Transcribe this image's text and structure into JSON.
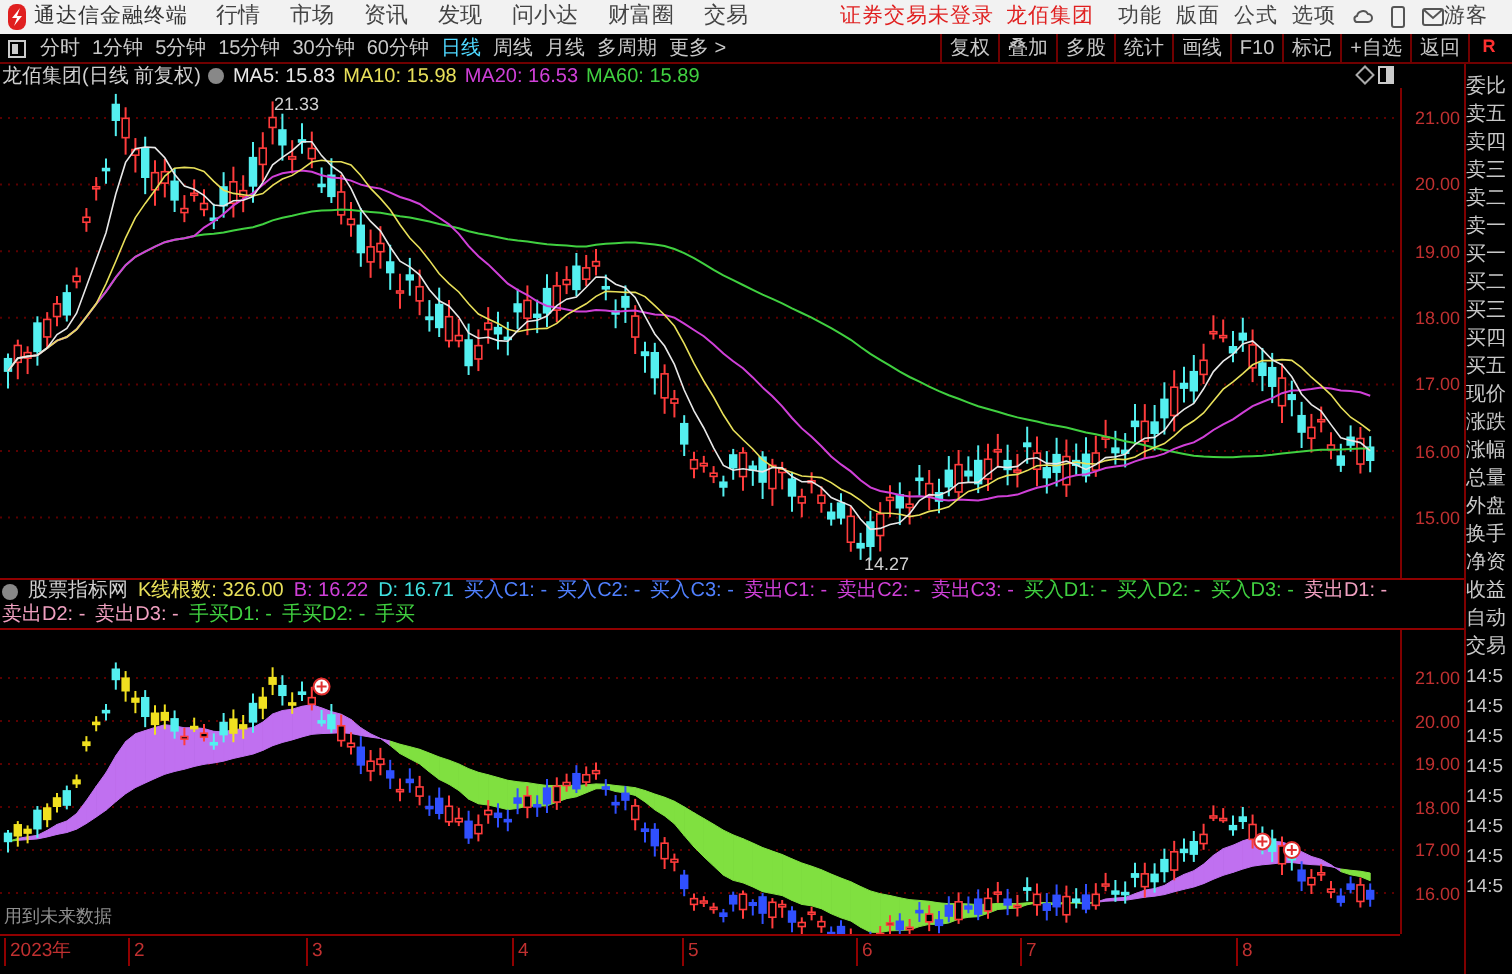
{
  "app_bar": {
    "app_name": "通达信金融终端",
    "menus": [
      "行情",
      "市场",
      "资讯",
      "发现",
      "问小达",
      "财富圈",
      "交易"
    ],
    "notice": "证券交易未登录",
    "stock": "龙佰集团",
    "tools": [
      "功能",
      "版面",
      "公式",
      "选项"
    ],
    "user": "游客"
  },
  "period_tabs": [
    {
      "label": "分时",
      "selected": false
    },
    {
      "label": "1分钟",
      "selected": false
    },
    {
      "label": "5分钟",
      "selected": false
    },
    {
      "label": "15分钟",
      "selected": false
    },
    {
      "label": "30分钟",
      "selected": false
    },
    {
      "label": "60分钟",
      "selected": false
    },
    {
      "label": "日线",
      "selected": true
    },
    {
      "label": "周线",
      "selected": false
    },
    {
      "label": "月线",
      "selected": false
    },
    {
      "label": "多周期",
      "selected": false
    },
    {
      "label": "更多 >",
      "selected": false
    }
  ],
  "chart_tools": [
    "复权",
    "叠加",
    "多股",
    "统计",
    "画线",
    "F10",
    "标记",
    "+自选",
    "返回"
  ],
  "corner_mark": "R",
  "main_chart": {
    "title": "龙佰集团(日线 前复权)",
    "legend": [
      {
        "label": "MA5: 15.83",
        "color": "#e8e8e8"
      },
      {
        "label": "MA10: 15.98",
        "color": "#e8e05a"
      },
      {
        "label": "MA20: 16.53",
        "color": "#d040d8"
      },
      {
        "label": "MA60: 15.89",
        "color": "#40d040"
      }
    ],
    "high_label": "21.33",
    "low_label": "14.27",
    "y_ticks": [
      "21.00",
      "20.00",
      "19.00",
      "18.00",
      "17.00",
      "16.00",
      "15.00"
    ]
  },
  "indicator": {
    "name": "股票指标网",
    "values": [
      {
        "label": "K线根数: 326.00",
        "color": "#e8e05a"
      },
      {
        "label": "B: 16.22",
        "color": "#d040d8"
      },
      {
        "label": "D: 16.71",
        "color": "#40e0e0"
      }
    ],
    "signals": [
      {
        "label": "买入C1: -",
        "color": "#5080ff"
      },
      {
        "label": "买入C2: -",
        "color": "#5080ff"
      },
      {
        "label": "买入C3: -",
        "color": "#5080ff"
      },
      {
        "label": "卖出C1: -",
        "color": "#d040d8"
      },
      {
        "label": "卖出C2: -",
        "color": "#d040d8"
      },
      {
        "label": "卖出C3: -",
        "color": "#d040d8"
      },
      {
        "label": "买入D1: -",
        "color": "#40d040"
      },
      {
        "label": "买入D2: -",
        "color": "#40d040"
      },
      {
        "label": "买入D3: -",
        "color": "#40d040"
      },
      {
        "label": "卖出D1: -",
        "color": "#f0a0c0"
      },
      {
        "label": "卖出D2: -",
        "color": "#f0a0c0"
      },
      {
        "label": "卖出D3: -",
        "color": "#f0a0c0"
      },
      {
        "label": "手买D1: -",
        "color": "#40d040"
      },
      {
        "label": "手买D2: -",
        "color": "#40d040"
      },
      {
        "label": "手买",
        "color": "#40d040"
      }
    ],
    "y_ticks": [
      "21.00",
      "20.00",
      "19.00",
      "18.00",
      "17.00",
      "16.00"
    ],
    "warning": "用到未来数据"
  },
  "date_axis": [
    "2023年",
    "2",
    "3",
    "4",
    "5",
    "6",
    "7",
    "8"
  ],
  "quote_panel": {
    "rows": [
      "委比",
      "卖五",
      "卖四",
      "卖三",
      "卖二",
      "卖一",
      "买一",
      "买二",
      "买三",
      "买四",
      "买五",
      "现价",
      "涨跌",
      "涨幅",
      "总量",
      "外盘",
      "换手",
      "净资",
      "收益",
      "自动",
      "交易"
    ],
    "times": [
      "14:5",
      "14:5",
      "14:5",
      "14:5",
      "14:5",
      "14:5",
      "14:5",
      "14:5"
    ]
  }
}
